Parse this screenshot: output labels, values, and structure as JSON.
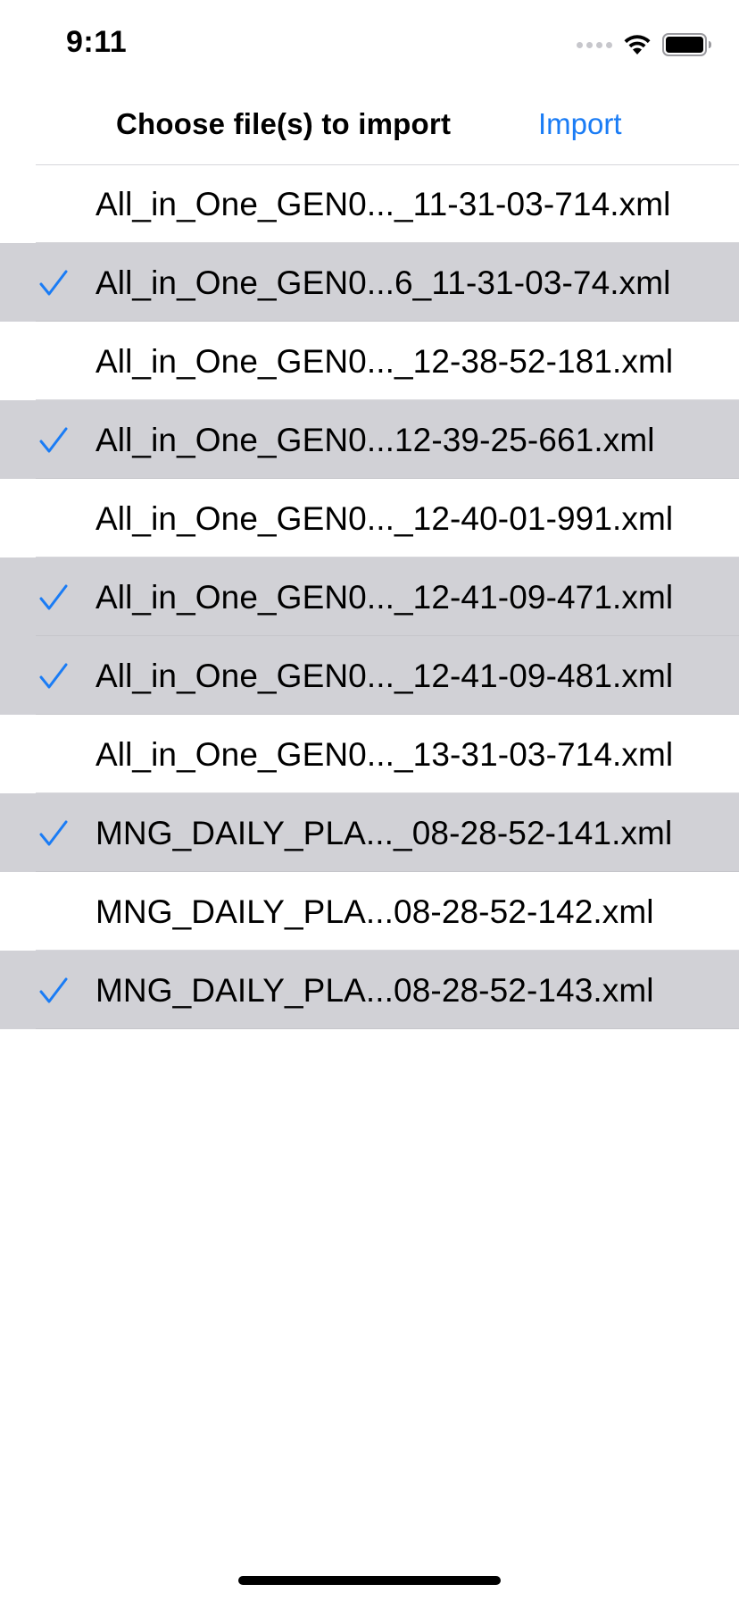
{
  "status_bar": {
    "time": "9:11",
    "icons": [
      "signal-icon",
      "wifi-icon",
      "battery-icon"
    ]
  },
  "nav": {
    "title": "Choose file(s) to import",
    "import_label": "Import"
  },
  "colors": {
    "accent": "#1a7cf5",
    "selected_row": "#d1d1d6",
    "separator": "#d8d8dc"
  },
  "files": [
    {
      "name": "All_in_One_GEN0..._11-31-03-714.xml",
      "selected": false
    },
    {
      "name": "All_in_One_GEN0...6_11-31-03-74.xml",
      "selected": true
    },
    {
      "name": "All_in_One_GEN0..._12-38-52-181.xml",
      "selected": false
    },
    {
      "name": "All_in_One_GEN0...12-39-25-661.xml",
      "selected": true
    },
    {
      "name": "All_in_One_GEN0..._12-40-01-991.xml",
      "selected": false
    },
    {
      "name": "All_in_One_GEN0..._12-41-09-471.xml",
      "selected": true
    },
    {
      "name": "All_in_One_GEN0..._12-41-09-481.xml",
      "selected": true
    },
    {
      "name": "All_in_One_GEN0..._13-31-03-714.xml",
      "selected": false
    },
    {
      "name": "MNG_DAILY_PLA..._08-28-52-141.xml",
      "selected": true
    },
    {
      "name": "MNG_DAILY_PLA...08-28-52-142.xml",
      "selected": false
    },
    {
      "name": "MNG_DAILY_PLA...08-28-52-143.xml",
      "selected": true
    }
  ]
}
